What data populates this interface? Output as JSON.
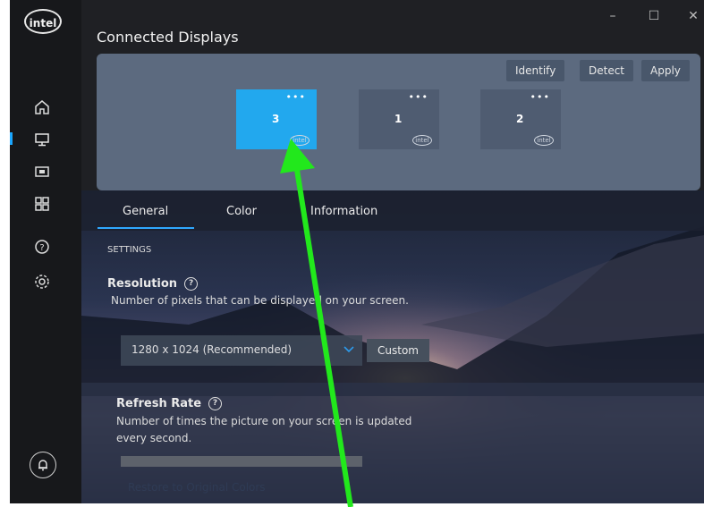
{
  "app": {
    "logo_text": "intel",
    "title": "Connected Displays"
  },
  "window_controls": {
    "minimize": "–",
    "maximize": "☐",
    "close": "✕"
  },
  "sidebar": {
    "items": [
      {
        "icon": "home-icon"
      },
      {
        "icon": "display-icon",
        "active": true
      },
      {
        "icon": "video-icon"
      },
      {
        "icon": "apps-grid-icon"
      },
      {
        "icon": "help-icon"
      },
      {
        "icon": "settings-icon"
      }
    ],
    "notifications_icon": "bell-icon"
  },
  "display_panel": {
    "buttons": [
      "Identify",
      "Detect",
      "Apply"
    ],
    "monitors": [
      {
        "number": "3",
        "menu": "•••",
        "logo": "intel",
        "selected": true
      },
      {
        "number": "1",
        "menu": "•••",
        "logo": "intel",
        "selected": false
      },
      {
        "number": "2",
        "menu": "•••",
        "logo": "intel",
        "selected": false
      }
    ]
  },
  "tabs": [
    "General",
    "Color",
    "Information"
  ],
  "settings": {
    "section_label": "SETTINGS",
    "resolution": {
      "label": "Resolution",
      "help": "?",
      "description": "Number of pixels that can be displayed on your screen.",
      "value": "1280 x 1024 (Recommended)",
      "custom_label": "Custom"
    },
    "refresh_rate": {
      "label": "Refresh Rate",
      "help": "?",
      "description_line1": "Number of times the picture on your screen is updated",
      "description_line2": "every second."
    },
    "restore_label": "Restore to Original Colors"
  },
  "colors": {
    "accent": "#1aa6ff",
    "selected_monitor": "#22a8ee",
    "annotation_arrow": "#22e81c"
  }
}
